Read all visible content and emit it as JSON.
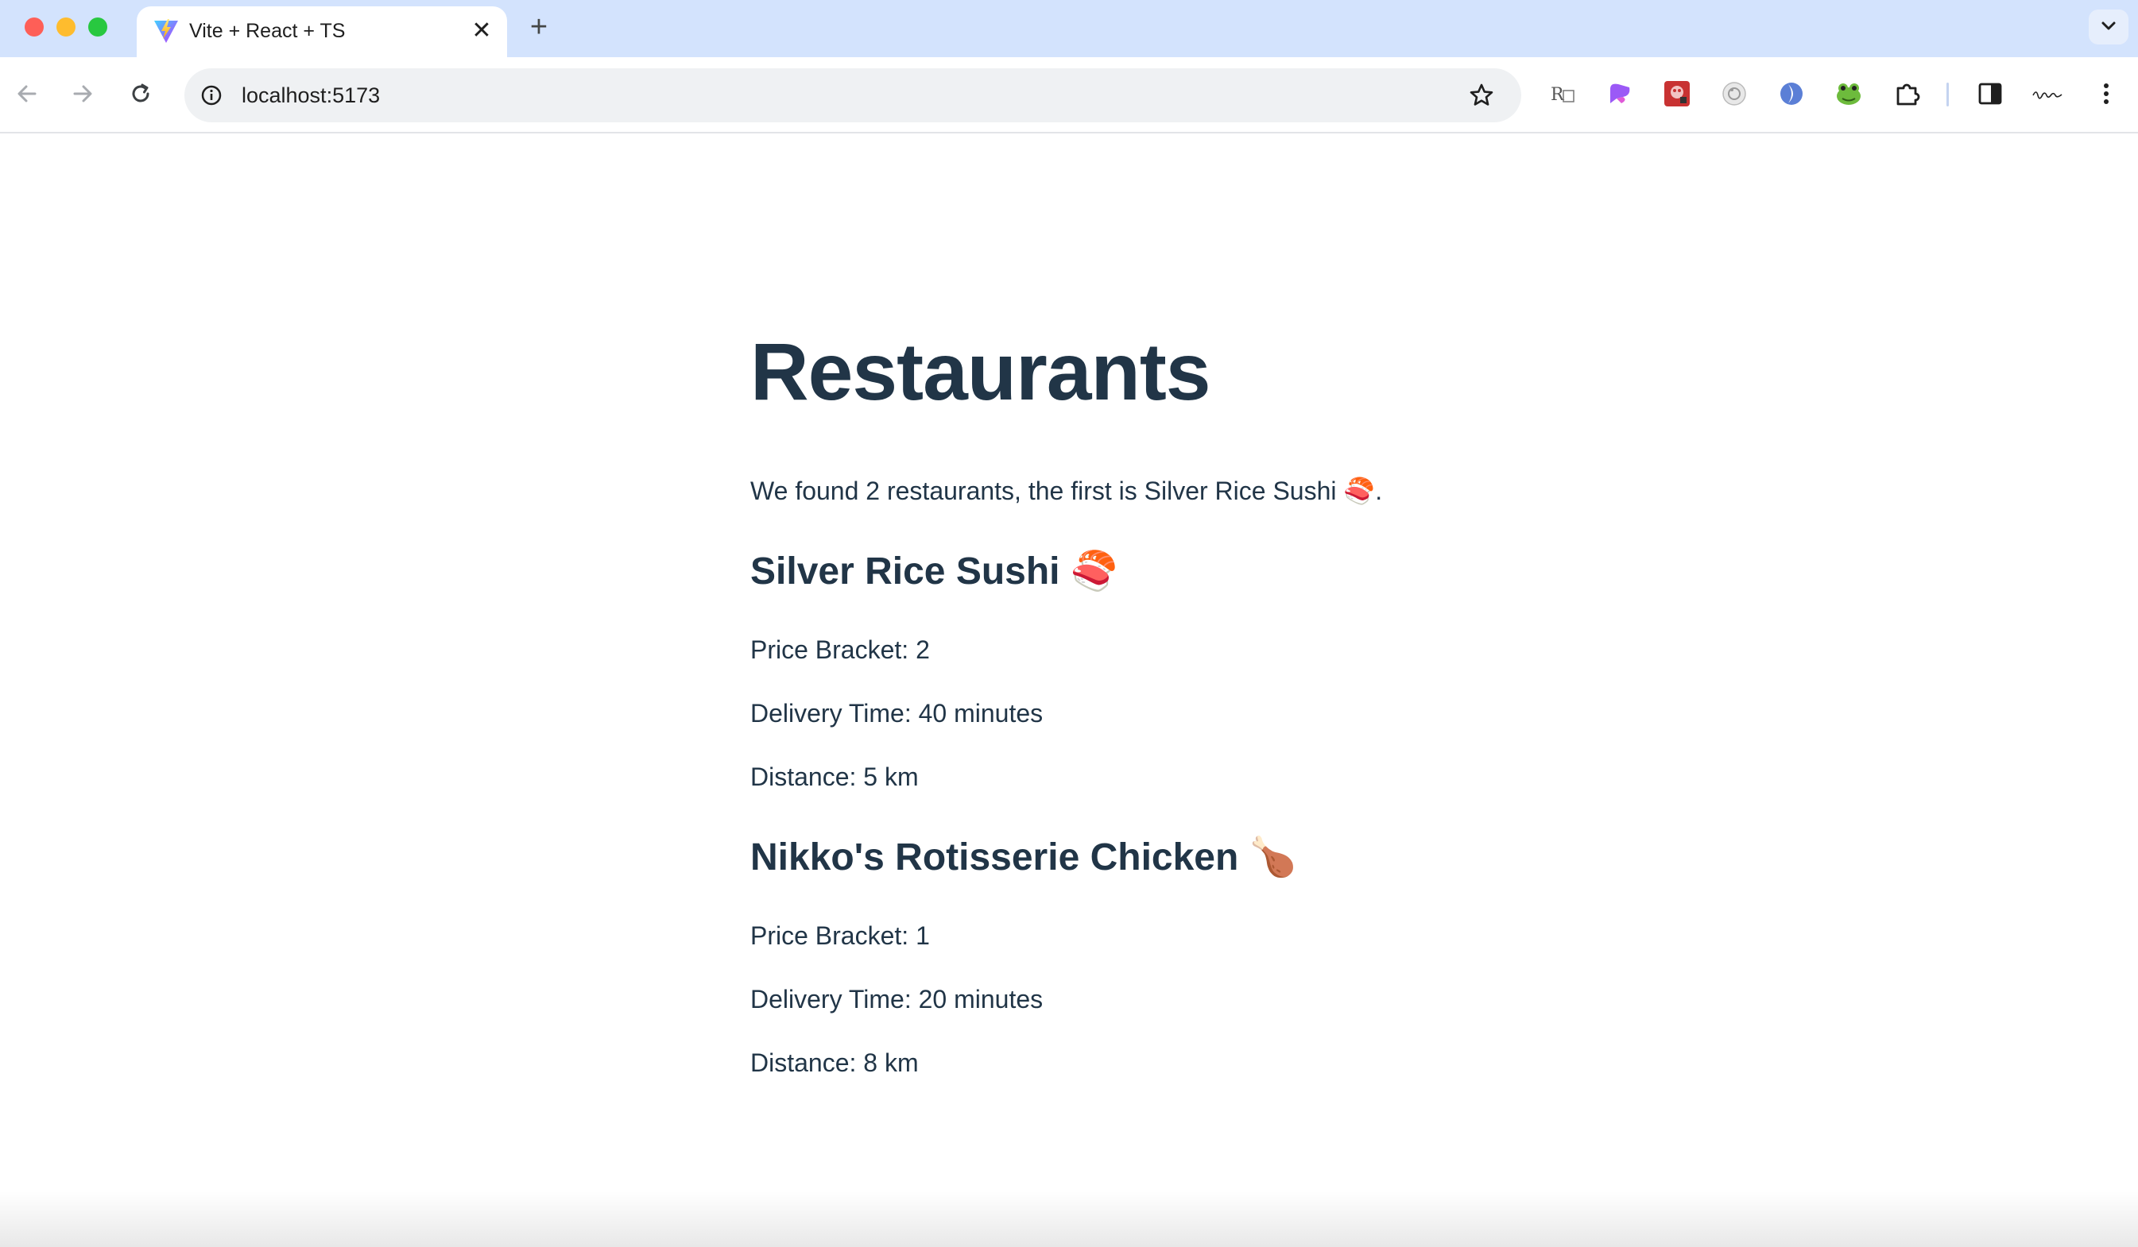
{
  "browser": {
    "tab": {
      "title": "Vite + React + TS",
      "favicon": "vite-logo-icon"
    },
    "address_bar": {
      "url": "localhost:5173"
    },
    "icons": {
      "back": "back-arrow-icon",
      "forward": "forward-arrow-icon",
      "reload": "reload-icon",
      "site_info": "info-icon",
      "bookmark": "star-icon",
      "extensions": [
        "reader-extension-icon",
        "purple-extension-icon",
        "red-extension-icon",
        "grey-circle-extension-icon",
        "blue-extension-icon",
        "frog-extension-icon",
        "puzzle-icon"
      ],
      "side_panel": "side-panel-icon",
      "profile": "profile-signature-icon",
      "menu": "kebab-menu-icon"
    }
  },
  "page": {
    "heading": "Restaurants",
    "summary": "We found 2 restaurants, the first is Silver Rice Sushi 🍣.",
    "restaurants": [
      {
        "name": "Silver Rice Sushi 🍣",
        "price": "Price Bracket: 2",
        "delivery": "Delivery Time: 40 minutes",
        "distance": "Distance: 5 km"
      },
      {
        "name": "Nikko's Rotisserie Chicken 🍗",
        "price": "Price Bracket: 1",
        "delivery": "Delivery Time: 20 minutes",
        "distance": "Distance: 8 km"
      }
    ]
  },
  "colors": {
    "text": "#213547",
    "tabstrip": "#d3e3fd",
    "omnibox": "#eff1f3"
  }
}
